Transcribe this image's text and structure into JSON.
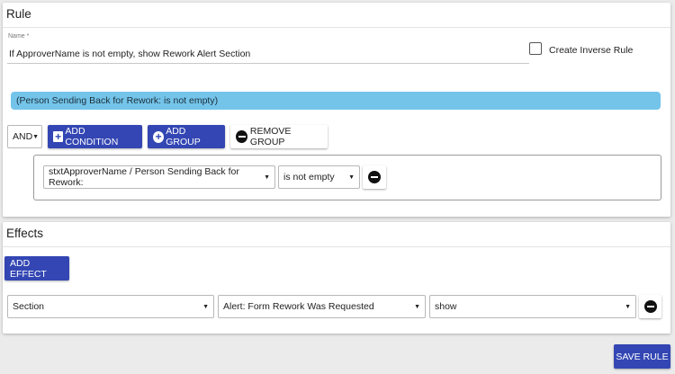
{
  "rule": {
    "title": "Rule",
    "name_label": "Name *",
    "name_value": "If ApproverName is not empty, show Rework Alert Section",
    "inverse_label": "Create Inverse Rule",
    "summary": "(Person Sending Back for Rework: is not empty)",
    "logic_value": "AND",
    "add_condition_label": "ADD CONDITION",
    "add_group_label": "ADD GROUP",
    "remove_group_label": "REMOVE GROUP",
    "condition": {
      "field": "stxtApproverName / Person Sending Back for Rework:",
      "operator": "is not empty"
    }
  },
  "effects": {
    "title": "Effects",
    "add_effect_label": "ADD EFFECT",
    "row": {
      "type": "Section",
      "target": "Alert: Form Rework Was Requested",
      "action": "show"
    }
  },
  "footer": {
    "save_label": "SAVE RULE"
  },
  "colors": {
    "accent": "#3346b3",
    "summary_bg": "#74c4ea"
  }
}
